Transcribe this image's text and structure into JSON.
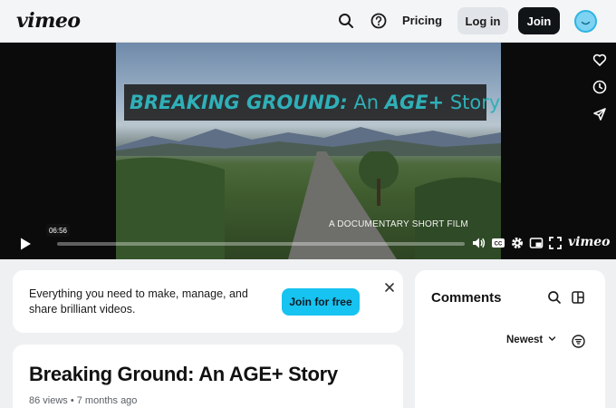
{
  "header": {
    "logo": "vimeo",
    "pricing_label": "Pricing",
    "login_label": "Log in",
    "join_label": "Join",
    "icons": [
      "search-icon",
      "help-icon",
      "avatar"
    ]
  },
  "player": {
    "title_bold": "BREAKING GROUND:",
    "title_an": " An ",
    "title_age": "AGE+",
    "title_rest": " Story",
    "overlay_subtitle": "A DOCUMENTARY SHORT FILM",
    "hover_time": "06:56",
    "brand": "vimeo",
    "side_icons": [
      "heart-icon",
      "clock-icon",
      "send-icon"
    ],
    "control_icons": [
      "play-icon",
      "volume-icon",
      "cc-icon",
      "settings-icon",
      "pip-icon",
      "fullscreen-icon"
    ],
    "accent_color": "#2fb0b8"
  },
  "promo": {
    "text": "Everything you need to make, manage, and share brilliant videos.",
    "button_label": "Join for free",
    "button_color": "#17c3f0"
  },
  "video": {
    "title": "Breaking Ground: An AGE+ Story",
    "meta": "86 views • 7 months ago"
  },
  "comments": {
    "title": "Comments",
    "sort_label": "Newest"
  }
}
